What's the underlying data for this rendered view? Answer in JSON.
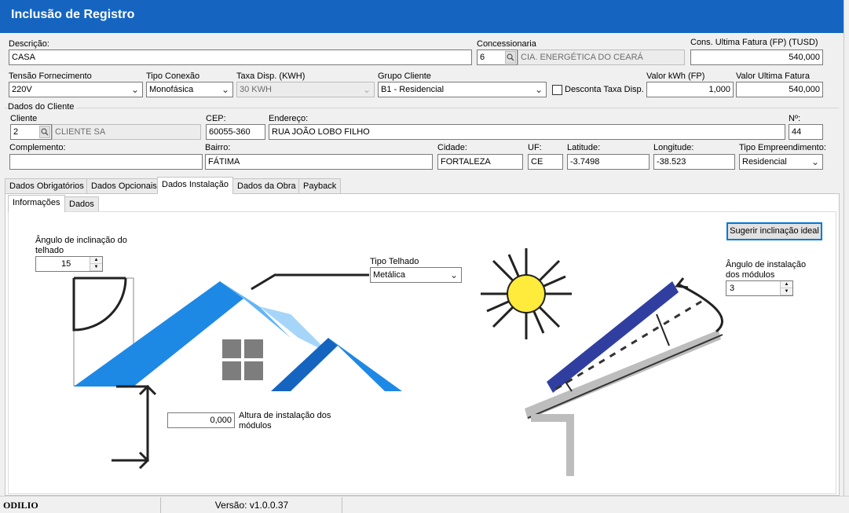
{
  "window": {
    "title": "Inclusão de Registro"
  },
  "form": {
    "descricao": {
      "label": "Descrição:",
      "value": "CASA"
    },
    "concessionaria": {
      "label": "Concessionaria",
      "code": "6",
      "name": "CIA. ENERGÉTICA DO CEARÁ"
    },
    "cons_ultima_fatura": {
      "label": "Cons. Ultima Fatura (FP) (TUSD)",
      "value": "540,000"
    },
    "tensao": {
      "label": "Tensão Fornecimento",
      "value": "220V"
    },
    "tipo_conexao": {
      "label": "Tipo Conexão",
      "value": "Monofásica"
    },
    "taxa_disp": {
      "label": "Taxa Disp. (KWH)",
      "value": "30 KWH"
    },
    "grupo_cliente": {
      "label": "Grupo Cliente",
      "value": "B1 - Residencial"
    },
    "desconta_taxa": {
      "label": "Desconta Taxa Disp.",
      "checked": false
    },
    "valor_kwh": {
      "label": "Valor kWh (FP)",
      "value": "1,000"
    },
    "valor_ultima_fatura": {
      "label": "Valor Ultima Fatura",
      "value": "540,000"
    }
  },
  "cliente": {
    "group_label": "Dados do Cliente",
    "cliente": {
      "label": "Cliente",
      "code": "2",
      "name": "CLIENTE SA"
    },
    "cep": {
      "label": "CEP:",
      "value": "60055-360"
    },
    "endereco": {
      "label": "Endereço:",
      "value": "RUA JOÃO LOBO FILHO"
    },
    "numero": {
      "label": "Nº:",
      "value": "44"
    },
    "complemento": {
      "label": "Complemento:",
      "value": ""
    },
    "bairro": {
      "label": "Bairro:",
      "value": "FÁTIMA"
    },
    "cidade": {
      "label": "Cidade:",
      "value": "FORTALEZA"
    },
    "uf": {
      "label": "UF:",
      "value": "CE"
    },
    "latitude": {
      "label": "Latitude:",
      "value": "-3.7498"
    },
    "longitude": {
      "label": "Longitude:",
      "value": "-38.523"
    },
    "tipo_empreendimento": {
      "label": "Tipo Empreendimento:",
      "value": "Residencial"
    }
  },
  "tabs": [
    "Dados Obrigatórios",
    "Dados Opcionais",
    "Dados Instalação",
    "Dados da Obra",
    "Payback"
  ],
  "active_tab": "Dados Instalação",
  "subtabs": [
    "Informações",
    "Dados"
  ],
  "active_subtab": "Informações",
  "instalacao": {
    "angulo_telhado": {
      "label": "Ângulo de inclinação do telhado",
      "value": "15"
    },
    "tipo_telhado": {
      "label": "Tipo Telhado",
      "value": "Metálica"
    },
    "altura": {
      "label": "Altura de instalação dos módulos",
      "value": "0,000"
    },
    "sugerir_button": "Sugerir inclinação ideal",
    "angulo_modulos": {
      "label": "Ângulo de instalação dos módulos",
      "value": "3"
    }
  },
  "status": {
    "user": "ODILIO",
    "version": "Versão: v1.0.0.37"
  },
  "colors": {
    "titlebar": "#1565c0",
    "roof": "#1e88e5",
    "sun": "#ffeb3b",
    "panel": "#303f9f"
  }
}
